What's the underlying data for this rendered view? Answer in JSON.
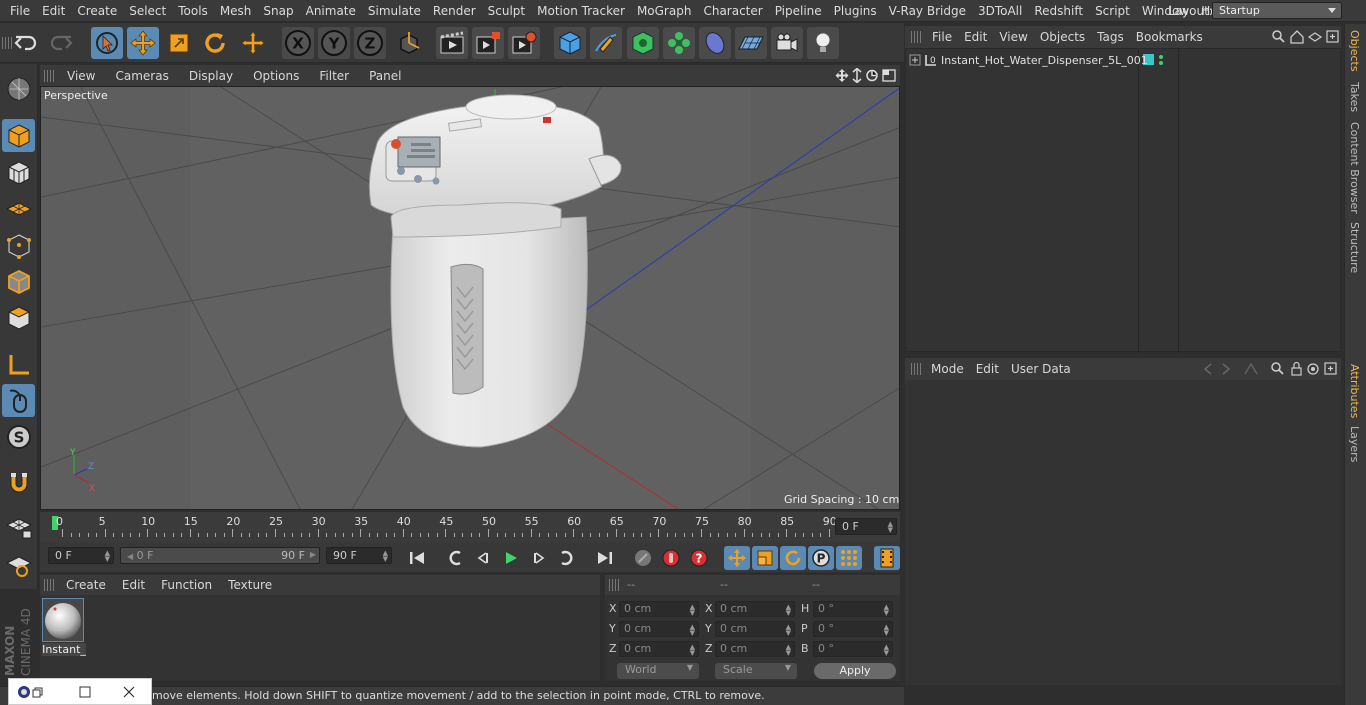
{
  "menubar": {
    "items": [
      "File",
      "Edit",
      "Create",
      "Select",
      "Tools",
      "Mesh",
      "Snap",
      "Animate",
      "Simulate",
      "Render",
      "Sculpt",
      "Motion Tracker",
      "MoGraph",
      "Character",
      "Pipeline",
      "Plugins",
      "V-Ray Bridge",
      "3DToAll",
      "Redshift",
      "Script",
      "Window",
      "Help"
    ],
    "layout_label": "Layout:",
    "layout_value": "Startup"
  },
  "toolbar": {
    "icons": [
      "undo-icon",
      "redo-icon",
      "live-selection-icon",
      "move-icon",
      "scale-icon",
      "rotate-icon",
      "recent-tool-icon",
      "x-axis-icon",
      "y-axis-icon",
      "z-axis-icon",
      "coordinate-system-icon",
      "render-view-icon",
      "render-picture-viewer-icon",
      "edit-render-settings-icon",
      "cube-icon",
      "pen-icon",
      "subdivision-icon",
      "cloner-icon",
      "deformer-icon",
      "floor-icon",
      "camera-icon",
      "light-icon"
    ],
    "axis_x": "X",
    "axis_y": "Y",
    "axis_z": "Z"
  },
  "viewport": {
    "menu": [
      "View",
      "Cameras",
      "Display",
      "Options",
      "Filter",
      "Panel"
    ],
    "label": "Perspective",
    "grid_spacing": "Grid Spacing : 10 cm"
  },
  "timeline": {
    "ticks": [
      "0",
      "5",
      "10",
      "15",
      "20",
      "25",
      "30",
      "35",
      "40",
      "45",
      "50",
      "55",
      "60",
      "65",
      "70",
      "75",
      "80",
      "85",
      "90"
    ],
    "current_frame": "0 F",
    "start_field": "0 F",
    "range_start": "0 F",
    "range_end": "90 F",
    "end_field": "90 F"
  },
  "material_manager": {
    "menu": [
      "Create",
      "Edit",
      "Function",
      "Texture"
    ],
    "material_name": "Instant_"
  },
  "coordinates": {
    "headers": [
      "--",
      "--",
      "--"
    ],
    "rows": [
      {
        "l1": "X",
        "v1": "0 cm",
        "l2": "X",
        "v2": "0 cm",
        "l3": "H",
        "v3": "0 °"
      },
      {
        "l1": "Y",
        "v1": "0 cm",
        "l2": "Y",
        "v2": "0 cm",
        "l3": "P",
        "v3": "0 °"
      },
      {
        "l1": "Z",
        "v1": "0 cm",
        "l2": "Z",
        "v2": "0 cm",
        "l3": "B",
        "v3": "0 °"
      }
    ],
    "mode_dropdown": "World",
    "scale_dropdown": "Scale",
    "apply_label": "Apply"
  },
  "object_manager": {
    "menu": [
      "File",
      "Edit",
      "View",
      "Objects",
      "Tags",
      "Bookmarks"
    ],
    "object_name": "Instant_Hot_Water_Dispenser_5L_001"
  },
  "attributes": {
    "menu": [
      "Mode",
      "Edit",
      "User Data"
    ]
  },
  "right_tabs": {
    "objects": "Objects",
    "takes": "Takes",
    "content_browser": "Content Browser",
    "structure": "Structure",
    "attributes": "Attributes",
    "layers": "Layers"
  },
  "status": {
    "text": "move elements. Hold down SHIFT to quantize movement / add to the selection in point mode, CTRL to remove."
  },
  "brand": {
    "line1": "MAXON",
    "line2": "CINEMA 4D"
  },
  "colors": {
    "accent": "#5b8ab5",
    "active_tab": "#f0b850",
    "timeline_marker": "#3fd36a"
  }
}
